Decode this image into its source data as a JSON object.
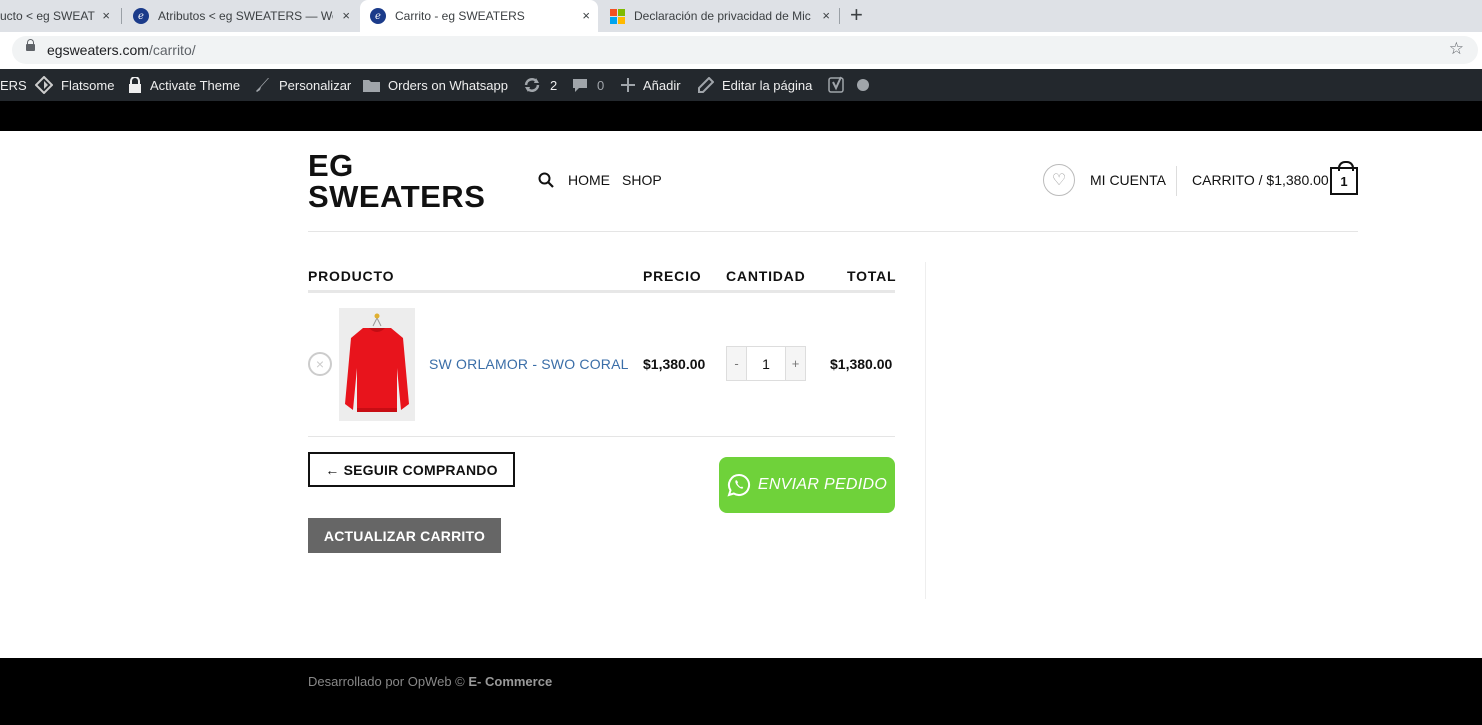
{
  "browser": {
    "tabs": [
      {
        "title": "ucto < eg SWEAT",
        "close": "×"
      },
      {
        "title": "Atributos < eg SWEATERS — Wo",
        "close": "×"
      },
      {
        "title": "Carrito - eg SWEATERS",
        "close": "×"
      },
      {
        "title": "Declaración de privacidad de Mic",
        "close": "×"
      }
    ],
    "new_tab": "+",
    "favicon_letter": "e",
    "url_host": "egsweaters.com",
    "url_path": "/carrito/",
    "bookmark_star": "☆"
  },
  "adminbar": {
    "site": "ERS",
    "flatsome": "Flatsome",
    "activate": "Activate Theme",
    "customize": "Personalizar",
    "orders": "Orders on Whatsapp",
    "updates_count": "2",
    "comments_count": "0",
    "add_new": "Añadir",
    "edit_page": "Editar la página"
  },
  "header": {
    "logo_line1": "EG",
    "logo_line2": "SWEATERS",
    "nav": [
      "HOME",
      "SHOP"
    ],
    "account": "MI CUENTA",
    "cart_label": "CARRITO / $1,380.00",
    "cart_count": "1"
  },
  "cart": {
    "columns": {
      "product": "PRODUCTO",
      "price": "PRECIO",
      "quantity": "CANTIDAD",
      "total": "TOTAL"
    },
    "items": [
      {
        "name": "SW ORLAMOR - SWO CORAL",
        "price": "$1,380.00",
        "qty": "1",
        "total": "$1,380.00"
      }
    ],
    "qty_minus": "-",
    "qty_plus": "+",
    "remove": "×",
    "continue_label": "← SEGUIR COMPRANDO",
    "update_label": "ACTUALIZAR CARRITO",
    "whatsapp_label": "ENVIAR PEDIDO"
  },
  "footer": {
    "text": "Desarrollado por OpWeb ©",
    "brand": "E- Commerce"
  },
  "colors": {
    "accent_link": "#3a6ea8",
    "whatsapp_green": "#6fd23a",
    "admin_bar": "#23282d"
  }
}
